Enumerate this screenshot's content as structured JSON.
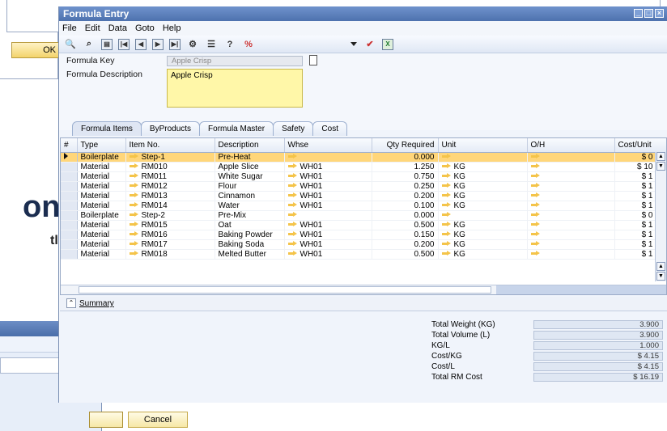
{
  "background": {
    "ok_label": "OK",
    "big_text_1": "on",
    "big_text_2": "tly",
    "cancel_label": "Cancel"
  },
  "window": {
    "title": "Formula Entry"
  },
  "menu": [
    "File",
    "Edit",
    "Data",
    "Goto",
    "Help"
  ],
  "form": {
    "formula_key_label": "Formula Key",
    "formula_key_value": "Apple Crisp",
    "formula_desc_label": "Formula Description",
    "formula_desc_value": "Apple Crisp"
  },
  "tabs": [
    "Formula Items",
    "ByProducts",
    "Formula Master",
    "Safety",
    "Cost"
  ],
  "grid": {
    "columns": [
      "#",
      "Type",
      "Item No.",
      "Description",
      "Whse",
      "Qty Required",
      "Unit",
      "O/H",
      "Cost/Unit"
    ],
    "rows": [
      {
        "type": "Boilerplate",
        "item": "Step-1",
        "desc": "Pre-Heat",
        "whse": "",
        "qty": "0.000",
        "unit": "",
        "cost": "$ 0"
      },
      {
        "type": "Material",
        "item": "RM010",
        "desc": "Apple Slice",
        "whse": "WH01",
        "qty": "1.250",
        "unit": "KG",
        "cost": "$ 10"
      },
      {
        "type": "Material",
        "item": "RM011",
        "desc": "White Sugar",
        "whse": "WH01",
        "qty": "0.750",
        "unit": "KG",
        "cost": "$ 1"
      },
      {
        "type": "Material",
        "item": "RM012",
        "desc": "Flour",
        "whse": "WH01",
        "qty": "0.250",
        "unit": "KG",
        "cost": "$ 1"
      },
      {
        "type": "Material",
        "item": "RM013",
        "desc": "Cinnamon",
        "whse": "WH01",
        "qty": "0.200",
        "unit": "KG",
        "cost": "$ 1"
      },
      {
        "type": "Material",
        "item": "RM014",
        "desc": "Water",
        "whse": "WH01",
        "qty": "0.100",
        "unit": "KG",
        "cost": "$ 1"
      },
      {
        "type": "Boilerplate",
        "item": "Step-2",
        "desc": "Pre-Mix",
        "whse": "",
        "qty": "0.000",
        "unit": "",
        "cost": "$ 0"
      },
      {
        "type": "Material",
        "item": "RM015",
        "desc": "Oat",
        "whse": "WH01",
        "qty": "0.500",
        "unit": "KG",
        "cost": "$ 1"
      },
      {
        "type": "Material",
        "item": "RM016",
        "desc": "Baking Powder",
        "whse": "WH01",
        "qty": "0.150",
        "unit": "KG",
        "cost": "$ 1"
      },
      {
        "type": "Material",
        "item": "RM017",
        "desc": "Baking Soda",
        "whse": "WH01",
        "qty": "0.200",
        "unit": "KG",
        "cost": "$ 1"
      },
      {
        "type": "Material",
        "item": "RM018",
        "desc": "Melted Butter",
        "whse": "WH01",
        "qty": "0.500",
        "unit": "KG",
        "cost": "$ 1"
      }
    ]
  },
  "summary_label": "Summary",
  "totals": [
    {
      "label": "Total Weight (KG)",
      "value": "3.900"
    },
    {
      "label": "Total Volume (L)",
      "value": "3.900"
    },
    {
      "label": "KG/L",
      "value": "1.000"
    },
    {
      "label": "Cost/KG",
      "value": "$ 4.15"
    },
    {
      "label": "Cost/L",
      "value": "$ 4.15"
    },
    {
      "label": "Total RM Cost",
      "value": "$ 16.19"
    }
  ],
  "colors": {
    "titlebar": "#4e72ae",
    "selected_row": "#ffd67a",
    "description_field": "#fff7a8",
    "link_arrow": "#f4c44a"
  }
}
